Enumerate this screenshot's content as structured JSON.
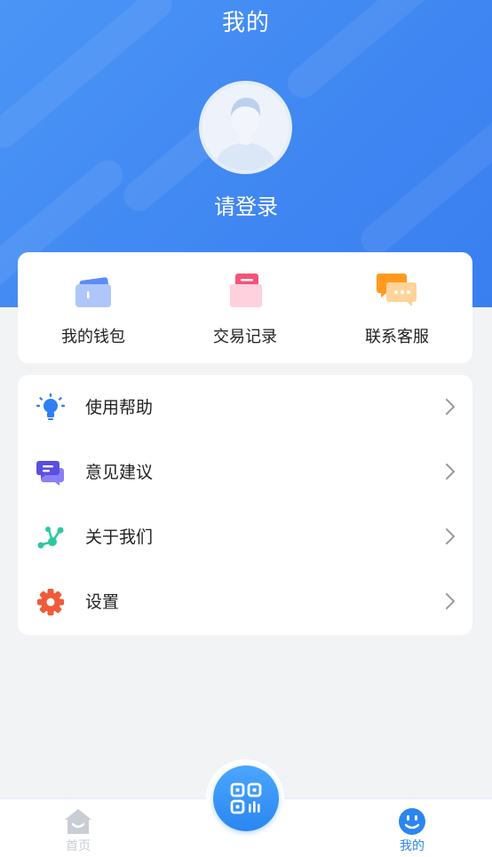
{
  "header": {
    "title": "我的",
    "login_prompt": "请登录"
  },
  "quick_actions": [
    {
      "label": "我的钱包",
      "icon": "wallet-icon"
    },
    {
      "label": "交易记录",
      "icon": "transaction-record-icon"
    },
    {
      "label": "联系客服",
      "icon": "customer-service-icon"
    }
  ],
  "menu": [
    {
      "label": "使用帮助",
      "icon": "lightbulb-icon"
    },
    {
      "label": "意见建议",
      "icon": "chat-bubbles-icon"
    },
    {
      "label": "关于我们",
      "icon": "nodes-icon"
    },
    {
      "label": "设置",
      "icon": "gear-icon"
    }
  ],
  "tabbar": {
    "home_label": "首页",
    "mine_label": "我的",
    "scan_icon": "qr-scan-icon",
    "active_color": "#2b86f0",
    "inactive_color": "#c9cdd4"
  }
}
